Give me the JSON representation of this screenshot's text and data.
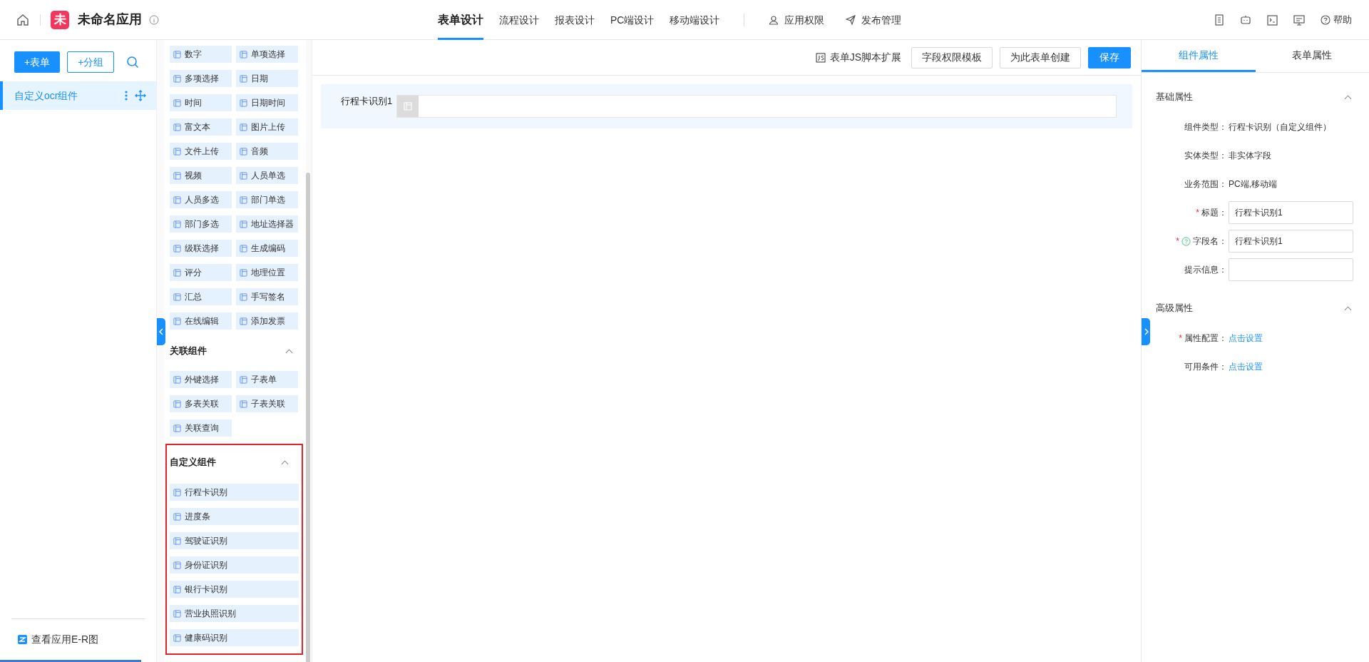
{
  "header": {
    "logo_char": "未",
    "app_name": "未命名应用",
    "nav": [
      {
        "label": "表单设计",
        "selected": true
      },
      {
        "label": "流程设计",
        "selected": false
      },
      {
        "label": "报表设计",
        "selected": false
      },
      {
        "label": "PC端设计",
        "selected": false
      },
      {
        "label": "移动端设计",
        "selected": false
      }
    ],
    "actions": [
      {
        "label": "应用权限",
        "kind": "user"
      },
      {
        "label": "发布管理",
        "kind": "send"
      }
    ],
    "help": "帮助"
  },
  "sidebar": {
    "buttons": [
      {
        "label": "+表单",
        "kind": "primary"
      },
      {
        "label": "+分组",
        "kind": "outline"
      }
    ],
    "groups": [
      {
        "label": "自定义ocr组件",
        "selected": true
      }
    ],
    "footer_link": "查看应用E-R图"
  },
  "palette": {
    "groups": [
      {
        "kind": "grid",
        "highlighted": false,
        "items": [
          "数字",
          "单项选择",
          "多项选择",
          "日期",
          "时间",
          "日期时间",
          "富文本",
          "图片上传",
          "文件上传",
          "音频",
          "视频",
          "人员单选",
          "人员多选",
          "部门单选",
          "部门多选",
          "地址选择器",
          "级联选择",
          "生成编码",
          "评分",
          "地理位置",
          "汇总",
          "手写签名",
          "在线编辑",
          "添加发票"
        ]
      },
      {
        "title": "关联组件",
        "expanded": true,
        "kind": "grid",
        "highlighted": false,
        "items": [
          "外键选择",
          "子表单",
          "多表关联",
          "子表关联",
          "关联查询"
        ]
      },
      {
        "title": "自定义组件",
        "expanded": true,
        "kind": "list",
        "highlighted": true,
        "items": [
          "行程卡识别",
          "进度条",
          "驾驶证识别",
          "身份证识别",
          "银行卡识别",
          "营业执照识别",
          "健康码识别"
        ]
      }
    ]
  },
  "toolbar": {
    "buttons": [
      {
        "label": "表单JS脚本扩展",
        "kind": "link"
      },
      {
        "label": "字段权限模板",
        "kind": "default"
      },
      {
        "label": "为此表单创建",
        "kind": "default"
      },
      {
        "label": "保存",
        "kind": "primary"
      }
    ]
  },
  "canvas": {
    "fields": [
      {
        "label": "行程卡识别1",
        "selected": true
      }
    ]
  },
  "properties": {
    "tabs": [
      {
        "label": "组件属性",
        "selected": true
      },
      {
        "label": "表单属性",
        "selected": false
      }
    ],
    "sections": [
      {
        "title": "基础属性",
        "expanded": true,
        "rows": [
          {
            "kind": "text",
            "label": "组件类型：",
            "value": "行程卡识别（自定义组件）",
            "help": false
          },
          {
            "kind": "text",
            "label": "实体类型：",
            "value": "非实体字段",
            "help": false
          },
          {
            "kind": "text",
            "label": "业务范围：",
            "value": "PC端,移动端",
            "help": false
          },
          {
            "kind": "input",
            "required_mark": "*",
            "label": "标题：",
            "value": "行程卡识别1",
            "help": false
          },
          {
            "kind": "input",
            "required_mark": "*",
            "label": "字段名：",
            "value": "行程卡识别1",
            "help": true
          },
          {
            "kind": "input",
            "label": "提示信息：",
            "help": false
          }
        ]
      },
      {
        "title": "高级属性",
        "expanded": true,
        "rows": [
          {
            "kind": "link",
            "required_mark": "*",
            "label": "属性配置：",
            "value": "点击设置",
            "help": false
          },
          {
            "kind": "link",
            "label": "可用条件：",
            "value": "点击设置",
            "help": false
          }
        ]
      }
    ]
  }
}
